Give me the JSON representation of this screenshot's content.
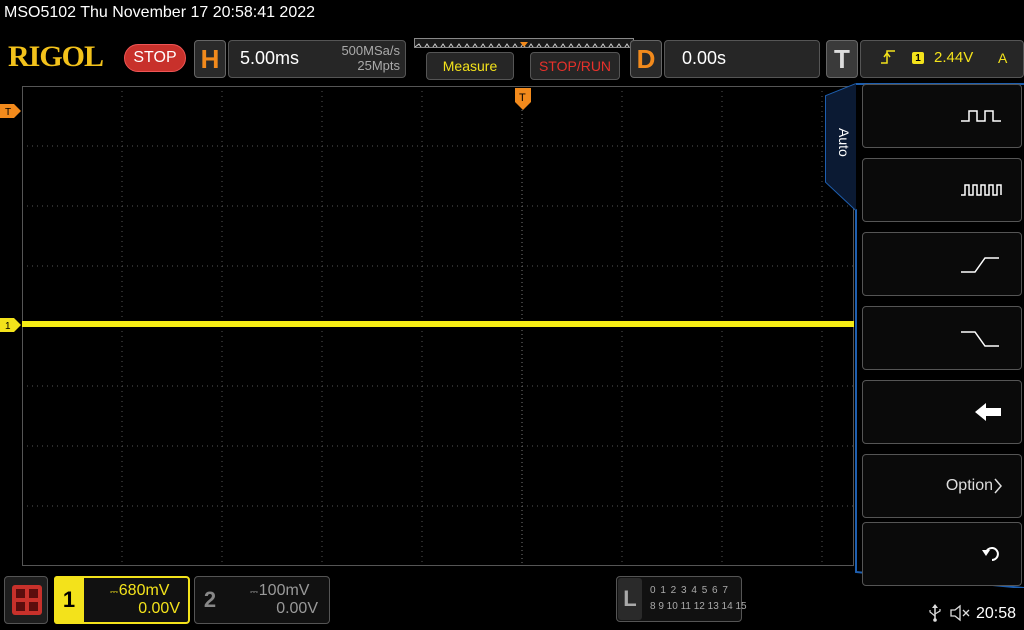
{
  "title_line": "MSO5102  Thu November 17 20:58:41 2022",
  "header": {
    "logo": "RIGOL",
    "status": "STOP",
    "horizontal": {
      "letter": "H",
      "scale": "5.00ms",
      "sample_rate": "500MSa/s",
      "mem_depth": "25Mpts"
    },
    "measure_label": "Measure",
    "runstop_label": "STOP/RUN",
    "delay": {
      "letter": "D",
      "value": "0.00s"
    },
    "trigger": {
      "letter": "T",
      "source": "1",
      "level": "2.44V",
      "mode": "A"
    }
  },
  "side_menu": {
    "tab_label": "Auto",
    "items": [
      {
        "icon": "single-pulse-icon"
      },
      {
        "icon": "pulse-train-icon"
      },
      {
        "icon": "rising-edge-icon"
      },
      {
        "icon": "falling-edge-icon"
      },
      {
        "icon": "back-arrow-icon"
      },
      {
        "label": "Option",
        "icon": "chevron-right-icon"
      },
      {
        "icon": "return-icon"
      }
    ]
  },
  "markers": {
    "trigger_level": "T",
    "trigger_position": "T",
    "ch1": "1"
  },
  "channels": [
    {
      "num": "1",
      "scale": "680mV",
      "offset": "0.00V",
      "color": "#f3e21b",
      "active": true
    },
    {
      "num": "2",
      "scale": "100mV",
      "offset": "0.00V",
      "color": "#999999",
      "active": false
    }
  ],
  "la": {
    "letter": "L",
    "row1": "0 1 2 3  4 5 6 7",
    "row2": "8 9 10 11 12 13 14 15"
  },
  "status_bar": {
    "clock": "20:58"
  },
  "colors": {
    "ch1": "#f3e21b",
    "accent_orange": "#f28a1c",
    "menu_border": "#1e5fb0",
    "stop_red": "#c8312b"
  }
}
